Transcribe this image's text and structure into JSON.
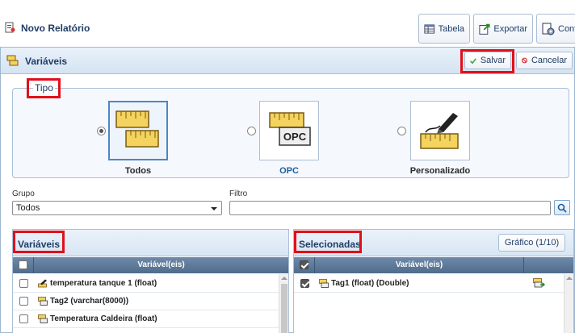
{
  "header": {
    "title": "Novo Relatório",
    "buttons": [
      {
        "label": "Tabela",
        "icon": "table-icon"
      },
      {
        "label": "Exportar",
        "icon": "export-icon"
      },
      {
        "label": "Conf",
        "icon": "config-icon"
      }
    ]
  },
  "panel": {
    "title": "Variáveis",
    "save_label": "Salvar",
    "cancel_label": "Cancelar"
  },
  "tipo": {
    "legend": "Tipo",
    "options": [
      {
        "label": "Todos",
        "selected": true,
        "icon": "rulers-icon"
      },
      {
        "label": "OPC",
        "selected": false,
        "icon": "opc-ruler-icon",
        "badge": "OPC"
      },
      {
        "label": "Personalizado",
        "selected": false,
        "icon": "pen-ruler-icon"
      }
    ]
  },
  "filters": {
    "grupo_label": "Grupo",
    "grupo_value": "Todos",
    "filtro_label": "Filtro",
    "filtro_value": ""
  },
  "variaveis": {
    "title": "Variáveis",
    "column": "Variável(eis)",
    "rows": [
      {
        "label": "temperatura tanque 1 (float)",
        "icon": "pen-ruler-icon",
        "checked": false
      },
      {
        "label": "Tag2 (varchar(8000))",
        "icon": "opc-tag-icon",
        "checked": false
      },
      {
        "label": "Temperatura Caldeira (float)",
        "icon": "opc-tag-icon",
        "checked": false
      }
    ]
  },
  "selecionadas": {
    "title": "Selecionadas",
    "chart_button": "Gráfico (1/10)",
    "column": "Variável(eis)",
    "rows": [
      {
        "label": "Tag1 (float) (Double)",
        "icon": "opc-tag-icon",
        "checked": true
      }
    ]
  },
  "colors": {
    "accent_red": "#e0101a",
    "heading_blue": "#1f3d66",
    "grid_header": "#5a7696"
  }
}
